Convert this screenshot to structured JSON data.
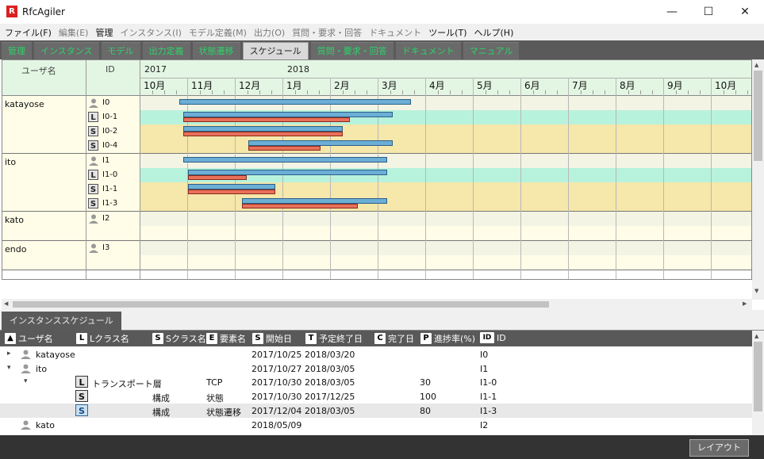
{
  "window": {
    "title": "RfcAgiler",
    "logo": "R",
    "minimize": "—",
    "maximize": "☐",
    "close": "✕"
  },
  "menu": [
    {
      "label": "ファイル(F)",
      "enabled": true
    },
    {
      "label": "編集(E)",
      "enabled": false
    },
    {
      "label": "管理",
      "enabled": true
    },
    {
      "label": "インスタンス(I)",
      "enabled": false
    },
    {
      "label": "モデル定義(M)",
      "enabled": false
    },
    {
      "label": "出力(O)",
      "enabled": false
    },
    {
      "label": "質問・要求・回答",
      "enabled": false
    },
    {
      "label": "ドキュメント",
      "enabled": false
    },
    {
      "label": "ツール(T)",
      "enabled": true
    },
    {
      "label": "ヘルプ(H)",
      "enabled": true
    }
  ],
  "tabs": [
    "管理",
    "インスタンス",
    "モデル",
    "出力定義",
    "状態遷移",
    "スケジュール",
    "質問・要求・回答",
    "ドキュメント",
    "マニュアル"
  ],
  "active_tab": 5,
  "gantt": {
    "col_user": "ユーザ名",
    "col_id": "ID",
    "years": [
      {
        "label": "2017",
        "month_index": 0
      },
      {
        "label": "2018",
        "month_index": 3
      }
    ],
    "months": [
      "10月",
      "11月",
      "12月",
      "1月",
      "2月",
      "3月",
      "4月",
      "5月",
      "6月",
      "7月",
      "8月",
      "9月",
      "10月"
    ],
    "users": [
      {
        "name": "katayose",
        "rows": [
          {
            "icon": "person",
            "id": "I0"
          },
          {
            "icon": "L",
            "id": "I0-1"
          },
          {
            "icon": "S",
            "id": "I0-2"
          },
          {
            "icon": "S",
            "id": "I0-4"
          }
        ]
      },
      {
        "name": "ito",
        "rows": [
          {
            "icon": "person",
            "id": "I1"
          },
          {
            "icon": "L",
            "id": "I1-0"
          },
          {
            "icon": "S",
            "id": "I1-1"
          },
          {
            "icon": "S",
            "id": "I1-3"
          }
        ]
      },
      {
        "name": "kato",
        "rows": [
          {
            "icon": "person",
            "id": "I2"
          },
          {
            "icon": "",
            "id": ""
          }
        ]
      },
      {
        "name": "endo",
        "rows": [
          {
            "icon": "person",
            "id": "I3"
          },
          {
            "icon": "",
            "id": ""
          }
        ]
      }
    ],
    "bars": [
      {
        "row": 0,
        "plan": [
          0.82,
          5.68
        ]
      },
      {
        "row": 1,
        "plan": [
          0.9,
          5.3
        ],
        "actual": [
          0.9,
          4.4
        ]
      },
      {
        "row": 2,
        "plan": [
          0.9,
          4.25
        ],
        "actual": [
          0.9,
          4.25
        ]
      },
      {
        "row": 3,
        "plan": [
          2.27,
          5.3
        ],
        "actual": [
          2.27,
          3.78
        ]
      },
      {
        "row": 4,
        "plan": [
          0.9,
          5.18
        ]
      },
      {
        "row": 5,
        "plan": [
          1.0,
          5.18
        ],
        "actual": [
          1.0,
          2.24
        ]
      },
      {
        "row": 6,
        "plan": [
          1.0,
          2.84
        ],
        "actual": [
          1.0,
          2.84
        ]
      },
      {
        "row": 7,
        "plan": [
          2.14,
          5.18
        ],
        "actual": [
          2.14,
          4.56
        ]
      }
    ],
    "group_colors": [
      "#f4f4e4",
      "#b7f2dc",
      "#f6e7aa",
      "#f6e7aa"
    ],
    "plan_color": "#6baed6",
    "actual_color": "#e8705a"
  },
  "bottom_tab": "インスタンススケジュール",
  "grid": {
    "columns": [
      {
        "key": "▲",
        "label": "ユーザ名"
      },
      {
        "key": "L",
        "label": "Lクラス名"
      },
      {
        "key": "S",
        "label": "Sクラス名"
      },
      {
        "key": "E",
        "label": "要素名"
      },
      {
        "key": "S",
        "label": "開始日"
      },
      {
        "key": "T",
        "label": "予定終了日"
      },
      {
        "key": "C",
        "label": "完了日"
      },
      {
        "key": "P",
        "label": "進捗率(%)"
      },
      {
        "key": "ID",
        "label": "ID"
      }
    ],
    "rows": [
      {
        "expand": "▸",
        "user": "katayose",
        "level": 0,
        "start": "2017/10/25",
        "end": "2018/03/20",
        "id": "I0"
      },
      {
        "expand": "▾",
        "user": "ito",
        "level": 0,
        "start": "2017/10/27",
        "end": "2018/03/05",
        "id": "I1"
      },
      {
        "expand": "▾",
        "icon": "L",
        "lclass": "トランスポート層",
        "element": "TCP",
        "level": 1,
        "start": "2017/10/30",
        "end": "2018/03/05",
        "progress": "30",
        "id": "I1-0"
      },
      {
        "icon": "S",
        "sclass": "構成",
        "element": "状態",
        "level": 2,
        "start": "2017/10/30",
        "end": "2017/12/25",
        "progress": "100",
        "id": "I1-1"
      },
      {
        "icon": "S",
        "sclass": "構成",
        "element": "状態遷移",
        "level": 2,
        "start": "2017/12/04",
        "end": "2018/03/05",
        "progress": "80",
        "id": "I1-3",
        "selected": true
      },
      {
        "user": "kato",
        "level": 0,
        "start": "2018/05/09",
        "id": "I2"
      }
    ]
  },
  "status": {
    "layout_button": "レイアウト"
  }
}
